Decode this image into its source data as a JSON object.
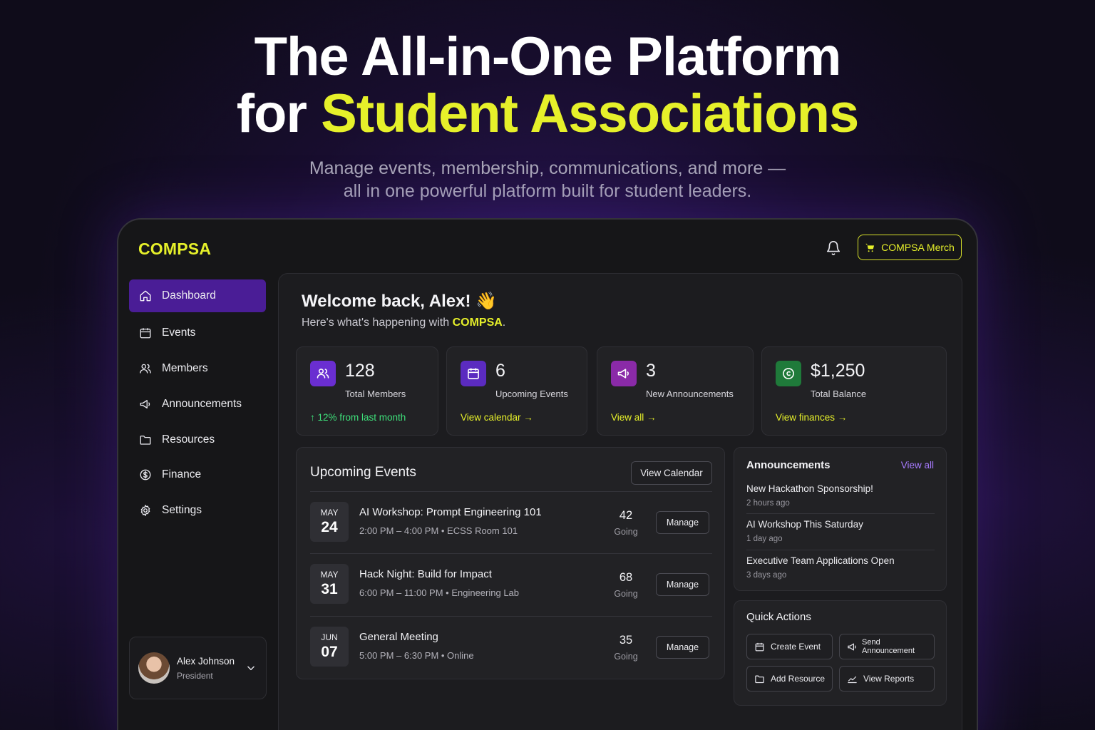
{
  "hero": {
    "line1": "The All-in-One Platform",
    "line2_prefix": "for ",
    "line2_accent": "Student Associations",
    "sub1": "Manage events, membership, communications, and more —",
    "sub2": "all in one powerful platform built for student leaders."
  },
  "app": {
    "logo": "COMPSA",
    "merch_label": "COMPSA Merch"
  },
  "sidebar": {
    "items": [
      {
        "label": "Dashboard",
        "icon": "home-icon",
        "active": true
      },
      {
        "label": "Events",
        "icon": "calendar-icon"
      },
      {
        "label": "Members",
        "icon": "users-icon"
      },
      {
        "label": "Announcements",
        "icon": "megaphone-icon"
      },
      {
        "label": "Resources",
        "icon": "folder-icon"
      },
      {
        "label": "Finance",
        "icon": "dollar-icon"
      },
      {
        "label": "Settings",
        "icon": "gear-icon"
      }
    ],
    "user": {
      "name": "Alex Johnson",
      "role": "President"
    }
  },
  "welcome": {
    "title": "Welcome back, Alex! 👋",
    "sub_prefix": "Here's what's happening with ",
    "sub_highlight": "COMPSA",
    "sub_suffix": "."
  },
  "stats": [
    {
      "value": "128",
      "label": "Total Members",
      "link": "↑ 12% from last month",
      "color": "#6a2ed1"
    },
    {
      "value": "6",
      "label": "Upcoming Events",
      "link": "View calendar →",
      "color": "#5b2bc0"
    },
    {
      "value": "3",
      "label": "New Announcements",
      "link": "View all →",
      "color": "#8a2aa8"
    },
    {
      "value": "$1,250",
      "label": "Total Balance",
      "link": "View finances →",
      "color": "#1f7a3a"
    }
  ],
  "events": {
    "title": "Upcoming Events",
    "view_calendar": "View Calendar",
    "going_label": "Going",
    "manage_label": "Manage",
    "rows": [
      {
        "month": "MAY",
        "day": "24",
        "name": "AI Workshop: Prompt Engineering 101",
        "meta": "2:00 PM – 4:00 PM • ECSS Room 101",
        "count": "42"
      },
      {
        "month": "MAY",
        "day": "31",
        "name": "Hack Night: Build for Impact",
        "meta": "6:00 PM – 11:00 PM • Engineering Lab",
        "count": "68"
      },
      {
        "month": "JUN",
        "day": "07",
        "name": "General Meeting",
        "meta": "5:00 PM – 6:30 PM • Online",
        "count": "35"
      }
    ]
  },
  "announcements": {
    "title": "Announcements",
    "view_all": "View all",
    "items": [
      {
        "title": "New Hackathon Sponsorship!",
        "time": "2 hours ago"
      },
      {
        "title": "AI Workshop This Saturday",
        "time": "1 day ago"
      },
      {
        "title": "Executive Team Applications Open",
        "time": "3 days ago"
      }
    ]
  },
  "quick_actions": {
    "title": "Quick Actions",
    "items": [
      {
        "label": "Create Event",
        "icon": "calendar-icon"
      },
      {
        "label": "Send Announcement",
        "icon": "megaphone-icon"
      },
      {
        "label": "Add Resource",
        "icon": "folder-icon"
      },
      {
        "label": "View Reports",
        "icon": "chart-line-icon"
      }
    ]
  }
}
